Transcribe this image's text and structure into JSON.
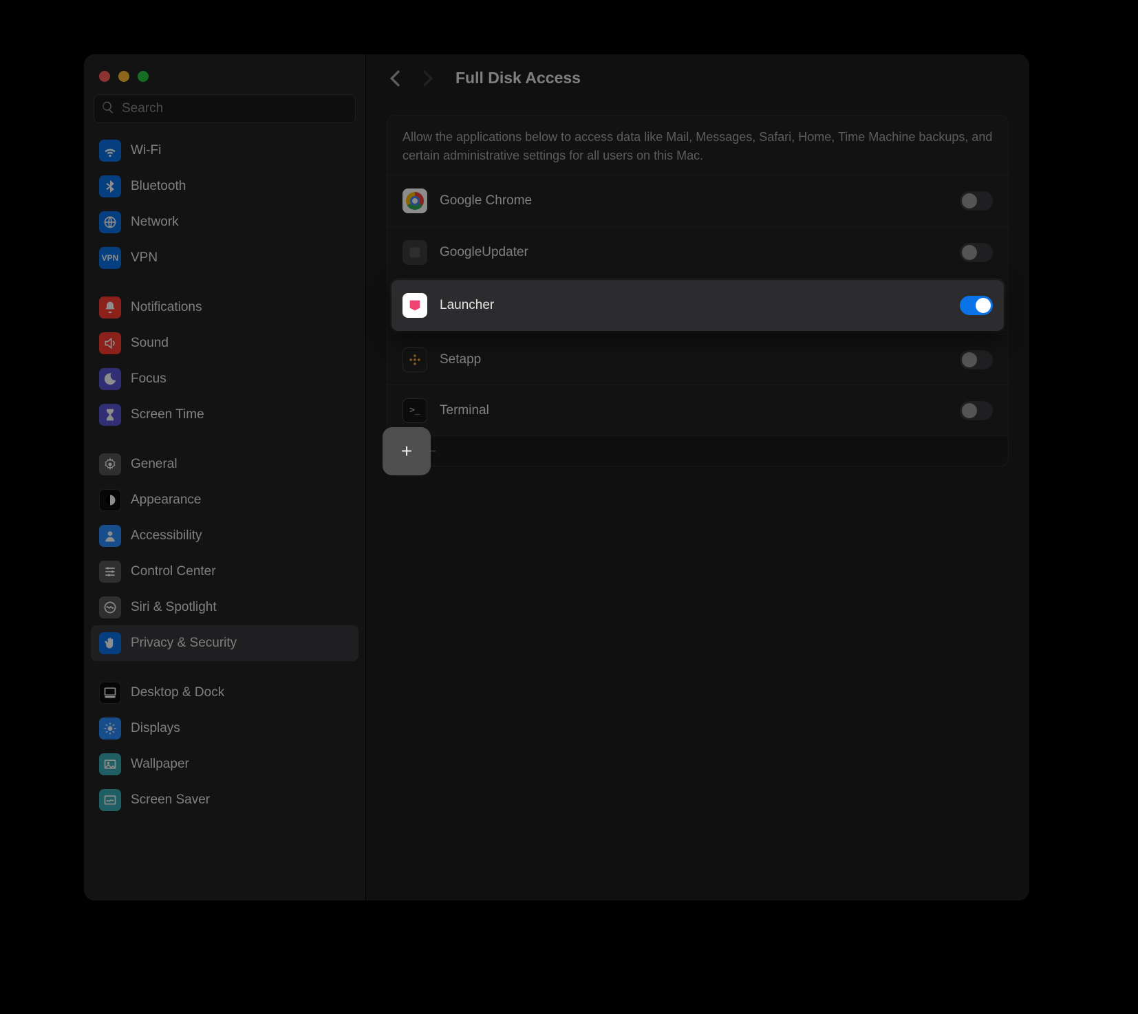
{
  "window": {
    "search_placeholder": "Search"
  },
  "header": {
    "title": "Full Disk Access"
  },
  "description": "Allow the applications below to access data like Mail, Messages, Safari, Home, Time Machine backups, and certain administrative settings for all users on this Mac.",
  "sidebar": {
    "groups": [
      {
        "items": [
          {
            "id": "wifi",
            "label": "Wi-Fi",
            "icon": "wifi",
            "cls": "ic-blue"
          },
          {
            "id": "bluetooth",
            "label": "Bluetooth",
            "icon": "bluetooth",
            "cls": "ic-blue"
          },
          {
            "id": "network",
            "label": "Network",
            "icon": "globe",
            "cls": "ic-blue"
          },
          {
            "id": "vpn",
            "label": "VPN",
            "icon": "vpn",
            "cls": "ic-blue"
          }
        ]
      },
      {
        "items": [
          {
            "id": "notifications",
            "label": "Notifications",
            "icon": "bell",
            "cls": "ic-redA"
          },
          {
            "id": "sound",
            "label": "Sound",
            "icon": "speaker",
            "cls": "ic-redA"
          },
          {
            "id": "focus",
            "label": "Focus",
            "icon": "moon",
            "cls": "ic-indigo"
          },
          {
            "id": "screentime",
            "label": "Screen Time",
            "icon": "hourglass",
            "cls": "ic-indigo"
          }
        ]
      },
      {
        "items": [
          {
            "id": "general",
            "label": "General",
            "icon": "gear",
            "cls": "ic-gray"
          },
          {
            "id": "appearance",
            "label": "Appearance",
            "icon": "appearance",
            "cls": "ic-black"
          },
          {
            "id": "accessibility",
            "label": "Accessibility",
            "icon": "person",
            "cls": "ic-blue2"
          },
          {
            "id": "controlcenter",
            "label": "Control Center",
            "icon": "sliders",
            "cls": "ic-gray"
          },
          {
            "id": "siri",
            "label": "Siri & Spotlight",
            "icon": "siri",
            "cls": "ic-gray"
          },
          {
            "id": "privacy",
            "label": "Privacy & Security",
            "icon": "hand",
            "cls": "ic-blue",
            "active": true
          }
        ]
      },
      {
        "items": [
          {
            "id": "desktop",
            "label": "Desktop & Dock",
            "icon": "desktop",
            "cls": "ic-black"
          },
          {
            "id": "displays",
            "label": "Displays",
            "icon": "sun",
            "cls": "ic-blue2"
          },
          {
            "id": "wallpaper",
            "label": "Wallpaper",
            "icon": "photo",
            "cls": "ic-teal"
          },
          {
            "id": "screensaver",
            "label": "Screen Saver",
            "icon": "saver",
            "cls": "ic-teal"
          }
        ]
      }
    ]
  },
  "apps": [
    {
      "id": "chrome",
      "name": "Google Chrome",
      "icon": "chrome",
      "enabled": false
    },
    {
      "id": "googleupdater",
      "name": "GoogleUpdater",
      "icon": "generic",
      "enabled": false
    },
    {
      "id": "launcher",
      "name": "Launcher",
      "icon": "launcher",
      "enabled": true,
      "highlight": true
    },
    {
      "id": "setapp",
      "name": "Setapp",
      "icon": "setapp",
      "enabled": false
    },
    {
      "id": "terminal",
      "name": "Terminal",
      "icon": "terminal",
      "enabled": false
    }
  ],
  "toolbar": {
    "add": "+",
    "remove": "−"
  }
}
